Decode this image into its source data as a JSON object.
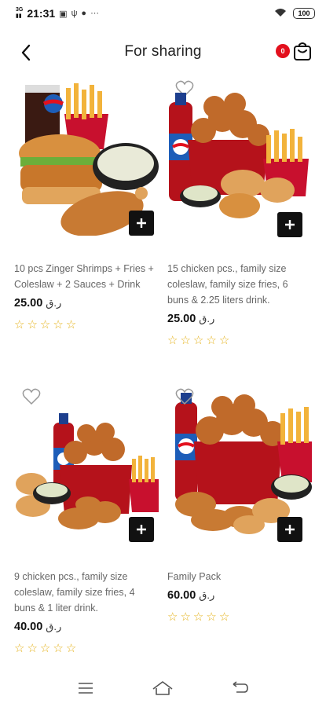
{
  "status_bar": {
    "network": "3G",
    "time": "21:31",
    "battery": "100"
  },
  "header": {
    "title": "For sharing",
    "cart_count": "0"
  },
  "products": [
    {
      "description": "10 pcs Zinger Shrimps + Fries + Coleslaw + 2 Sauces + Drink",
      "price": "25.00",
      "currency": "ر.ق",
      "rating_stars": 0
    },
    {
      "description": "15 chicken pcs., family size coleslaw, family size fries, 6 buns & 2.25 liters drink.",
      "price": "25.00",
      "currency": "ر.ق",
      "rating_stars": 0
    },
    {
      "description": "9 chicken pcs., family size coleslaw, family size fries, 4 buns & 1 liter drink.",
      "price": "40.00",
      "currency": "ر.ق",
      "rating_stars": 0
    },
    {
      "description": "Family Pack",
      "price": "60.00",
      "currency": "ر.ق",
      "rating_stars": 0
    }
  ],
  "colors": {
    "badge": "#e3101d",
    "star": "#e5b21a",
    "add_button": "#111111",
    "bucket_red": "#b5121b"
  }
}
